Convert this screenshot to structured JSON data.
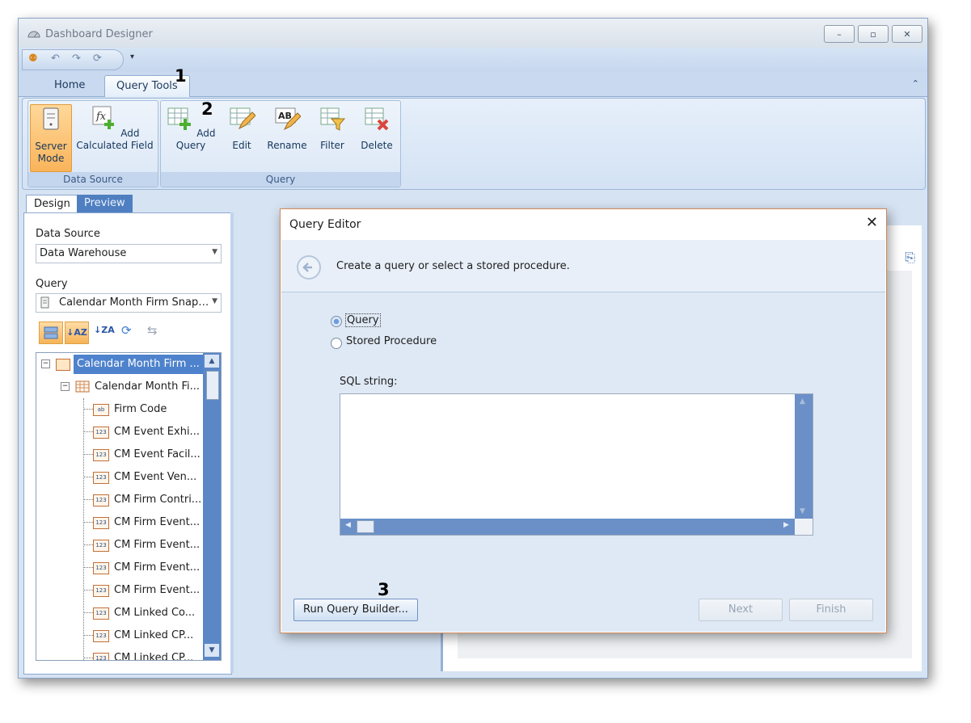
{
  "window": {
    "title": "Dashboard Designer",
    "controls": [
      "–",
      "▫",
      "✕"
    ]
  },
  "ribbon": {
    "tabs": [
      {
        "label": "Home"
      },
      {
        "label": "Query Tools"
      }
    ],
    "groups": {
      "data_source": {
        "label": "Data Source",
        "server_mode": "Server Mode",
        "add_calc_field": "Add Calculated Field"
      },
      "query": {
        "label": "Query",
        "add_query": "Add Query",
        "edit": "Edit",
        "rename": "Rename",
        "filter": "Filter",
        "delete": "Delete"
      }
    }
  },
  "left_panel": {
    "tabs": {
      "design": "Design",
      "preview": "Preview"
    },
    "data_source_label": "Data Source",
    "data_source_value": "Data Warehouse",
    "query_label": "Query",
    "query_value": "Calendar Month Firm Snap…",
    "tree": {
      "root": "Calendar Month Firm ...",
      "table": "Calendar Month Fi...",
      "fields": [
        {
          "label": "Firm Code",
          "type": "ab"
        },
        {
          "label": "CM Event Exhi...",
          "type": "123"
        },
        {
          "label": "CM Event Facil...",
          "type": "123"
        },
        {
          "label": "CM Event Ven...",
          "type": "123"
        },
        {
          "label": "CM Firm Contri...",
          "type": "123"
        },
        {
          "label": "CM Firm Event...",
          "type": "123"
        },
        {
          "label": "CM Firm Event...",
          "type": "123"
        },
        {
          "label": "CM Firm Event...",
          "type": "123"
        },
        {
          "label": "CM Firm Event...",
          "type": "123"
        },
        {
          "label": "CM Linked Co...",
          "type": "123"
        },
        {
          "label": "CM Linked CP...",
          "type": "123"
        },
        {
          "label": "CM Linked CP...",
          "type": "123"
        }
      ]
    }
  },
  "dialog": {
    "title": "Query Editor",
    "close": "✕",
    "subtitle": "Create a query or select a stored procedure.",
    "options": {
      "query": "Query",
      "stored_procedure": "Stored Procedure",
      "selected": "query"
    },
    "sql_label": "SQL string:",
    "sql_value": "",
    "run_query_builder": "Run Query Builder...",
    "next": "Next",
    "finish": "Finish"
  },
  "callouts": [
    "1",
    "2",
    "3"
  ],
  "colors": {
    "ribbon_bg": "#d3e2f4",
    "selected_orange": "#f9b45a",
    "scroll_blue": "#5b87c7",
    "dialog_border": "#d08a5a"
  }
}
